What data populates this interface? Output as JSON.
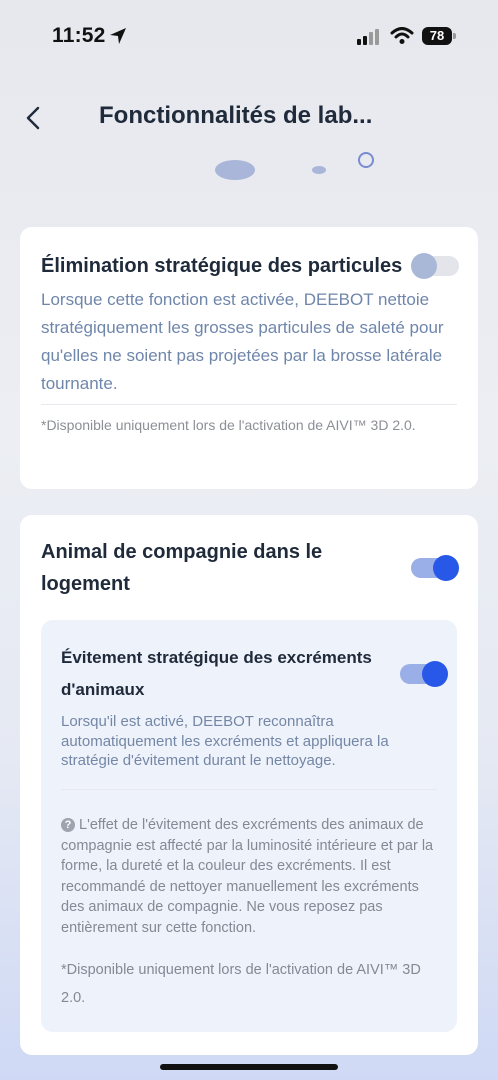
{
  "status_bar": {
    "time": "11:52",
    "battery": "78"
  },
  "header": {
    "title": "Fonctionnalités de lab..."
  },
  "card1": {
    "title": "Élimination stratégique des particules",
    "toggle_on": false,
    "description": "Lorsque cette fonction est activée, DEEBOT nettoie stratégiquement les grosses particules de saleté pour qu'elles ne soient pas projetées par la brosse latérale tournante.",
    "note": "*Disponible uniquement lors de l'activation de AIVI™ 3D 2.0."
  },
  "card2": {
    "title": "Animal de compagnie dans le logement",
    "toggle_on": true,
    "sub": {
      "title": "Évitement stratégique des excréments d'animaux",
      "toggle_on": true,
      "description": "Lorsqu'il est activé, DEEBOT reconnaîtra automatiquement les excréments et appliquera la stratégie d'évitement durant le nettoyage.",
      "info": "L'effet de l'évitement des excréments des animaux de compagnie est affecté par la luminosité intérieure et par la forme, la dureté et la couleur des excréments. Il est recommandé de nettoyer manuellement les excréments des animaux de compagnie. Ne vous reposez pas entièrement sur cette fonction.",
      "note": "*Disponible uniquement lors de l'activation de AIVI™ 3D 2.0."
    }
  },
  "colors": {
    "accent": "#2758e8",
    "text_secondary": "#6f86ab"
  },
  "icons": [
    "location-arrow-icon",
    "cellular-signal-icon",
    "wifi-icon",
    "battery-icon",
    "back-chevron-icon",
    "help-icon"
  ]
}
